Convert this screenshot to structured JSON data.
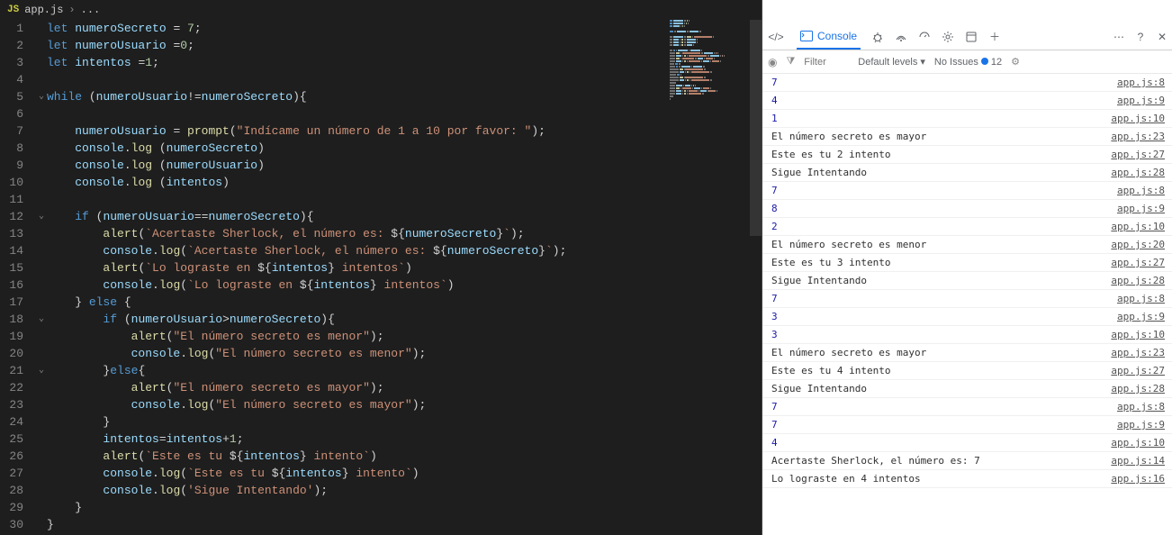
{
  "editor": {
    "file_icon": "JS",
    "file_name": "app.js",
    "breadcrumb_rest": "...",
    "line_numbers": [
      "1",
      "2",
      "3",
      "4",
      "5",
      "6",
      "7",
      "8",
      "9",
      "10",
      "11",
      "12",
      "13",
      "14",
      "15",
      "16",
      "17",
      "18",
      "19",
      "20",
      "21",
      "22",
      "23",
      "24",
      "25",
      "26",
      "27",
      "28",
      "29",
      "30"
    ],
    "fold_markers": {
      "5": "v",
      "12": "v",
      "18": "v",
      "21": "v"
    },
    "code_lines": [
      [
        [
          "kw",
          "let "
        ],
        [
          "var",
          "numeroSecreto"
        ],
        [
          "pun",
          " = "
        ],
        [
          "num",
          "7"
        ],
        [
          "pun",
          ";"
        ]
      ],
      [
        [
          "kw",
          "let "
        ],
        [
          "var",
          "numeroUsuario"
        ],
        [
          "pun",
          " ="
        ],
        [
          "num",
          "0"
        ],
        [
          "pun",
          ";"
        ]
      ],
      [
        [
          "kw",
          "let "
        ],
        [
          "var",
          "intentos"
        ],
        [
          "pun",
          " ="
        ],
        [
          "num",
          "1"
        ],
        [
          "pun",
          ";"
        ]
      ],
      [],
      [
        [
          "kw",
          "while"
        ],
        [
          "pun",
          " ("
        ],
        [
          "var",
          "numeroUsuario"
        ],
        [
          "pun",
          "!="
        ],
        [
          "var",
          "numeroSecreto"
        ],
        [
          "pun",
          "){"
        ]
      ],
      [],
      [
        [
          "pun",
          "    "
        ],
        [
          "var",
          "numeroUsuario"
        ],
        [
          "pun",
          " = "
        ],
        [
          "fn",
          "prompt"
        ],
        [
          "pun",
          "("
        ],
        [
          "str",
          "\"Indícame un número de 1 a 10 por favor: \""
        ],
        [
          "pun",
          ");"
        ]
      ],
      [
        [
          "pun",
          "    "
        ],
        [
          "var",
          "console"
        ],
        [
          "pun",
          "."
        ],
        [
          "fn",
          "log"
        ],
        [
          "pun",
          " ("
        ],
        [
          "var",
          "numeroSecreto"
        ],
        [
          "pun",
          ")"
        ]
      ],
      [
        [
          "pun",
          "    "
        ],
        [
          "var",
          "console"
        ],
        [
          "pun",
          "."
        ],
        [
          "fn",
          "log"
        ],
        [
          "pun",
          " ("
        ],
        [
          "var",
          "numeroUsuario"
        ],
        [
          "pun",
          ")"
        ]
      ],
      [
        [
          "pun",
          "    "
        ],
        [
          "var",
          "console"
        ],
        [
          "pun",
          "."
        ],
        [
          "fn",
          "log"
        ],
        [
          "pun",
          " ("
        ],
        [
          "var",
          "intentos"
        ],
        [
          "pun",
          ")"
        ]
      ],
      [],
      [
        [
          "pun",
          "    "
        ],
        [
          "kw",
          "if"
        ],
        [
          "pun",
          " ("
        ],
        [
          "var",
          "numeroUsuario"
        ],
        [
          "pun",
          "=="
        ],
        [
          "var",
          "numeroSecreto"
        ],
        [
          "pun",
          "){"
        ]
      ],
      [
        [
          "pun",
          "        "
        ],
        [
          "fn",
          "alert"
        ],
        [
          "pun",
          "("
        ],
        [
          "tpl",
          "`Acertaste Sherlock, el número es: "
        ],
        [
          "pun",
          "${"
        ],
        [
          "var",
          "numeroSecreto"
        ],
        [
          "pun",
          "}"
        ],
        [
          "tpl",
          "`"
        ],
        [
          "pun",
          ");"
        ]
      ],
      [
        [
          "pun",
          "        "
        ],
        [
          "var",
          "console"
        ],
        [
          "pun",
          "."
        ],
        [
          "fn",
          "log"
        ],
        [
          "pun",
          "("
        ],
        [
          "tpl",
          "`Acertaste Sherlock, el número es: "
        ],
        [
          "pun",
          "${"
        ],
        [
          "var",
          "numeroSecreto"
        ],
        [
          "pun",
          "}"
        ],
        [
          "tpl",
          "`"
        ],
        [
          "pun",
          ");"
        ]
      ],
      [
        [
          "pun",
          "        "
        ],
        [
          "fn",
          "alert"
        ],
        [
          "pun",
          "("
        ],
        [
          "tpl",
          "`Lo lograste en "
        ],
        [
          "pun",
          "${"
        ],
        [
          "var",
          "intentos"
        ],
        [
          "pun",
          "}"
        ],
        [
          "tpl",
          " intentos`"
        ],
        [
          "pun",
          ")"
        ]
      ],
      [
        [
          "pun",
          "        "
        ],
        [
          "var",
          "console"
        ],
        [
          "pun",
          "."
        ],
        [
          "fn",
          "log"
        ],
        [
          "pun",
          "("
        ],
        [
          "tpl",
          "`Lo lograste en "
        ],
        [
          "pun",
          "${"
        ],
        [
          "var",
          "intentos"
        ],
        [
          "pun",
          "}"
        ],
        [
          "tpl",
          " intentos`"
        ],
        [
          "pun",
          ")"
        ]
      ],
      [
        [
          "pun",
          "    } "
        ],
        [
          "kw",
          "else"
        ],
        [
          "pun",
          " {"
        ]
      ],
      [
        [
          "pun",
          "        "
        ],
        [
          "kw",
          "if"
        ],
        [
          "pun",
          " ("
        ],
        [
          "var",
          "numeroUsuario"
        ],
        [
          "pun",
          ">"
        ],
        [
          "var",
          "numeroSecreto"
        ],
        [
          "pun",
          "){"
        ]
      ],
      [
        [
          "pun",
          "            "
        ],
        [
          "fn",
          "alert"
        ],
        [
          "pun",
          "("
        ],
        [
          "str",
          "\"El número secreto es menor\""
        ],
        [
          "pun",
          ");"
        ]
      ],
      [
        [
          "pun",
          "            "
        ],
        [
          "var",
          "console"
        ],
        [
          "pun",
          "."
        ],
        [
          "fn",
          "log"
        ],
        [
          "pun",
          "("
        ],
        [
          "str",
          "\"El número secreto es menor\""
        ],
        [
          "pun",
          ");"
        ]
      ],
      [
        [
          "pun",
          "        }"
        ],
        [
          "kw",
          "else"
        ],
        [
          "pun",
          "{"
        ]
      ],
      [
        [
          "pun",
          "            "
        ],
        [
          "fn",
          "alert"
        ],
        [
          "pun",
          "("
        ],
        [
          "str",
          "\"El número secreto es mayor\""
        ],
        [
          "pun",
          ");"
        ]
      ],
      [
        [
          "pun",
          "            "
        ],
        [
          "var",
          "console"
        ],
        [
          "pun",
          "."
        ],
        [
          "fn",
          "log"
        ],
        [
          "pun",
          "("
        ],
        [
          "str",
          "\"El número secreto es mayor\""
        ],
        [
          "pun",
          ");"
        ]
      ],
      [
        [
          "pun",
          "        }"
        ]
      ],
      [
        [
          "pun",
          "        "
        ],
        [
          "var",
          "intentos"
        ],
        [
          "pun",
          "="
        ],
        [
          "var",
          "intentos"
        ],
        [
          "pun",
          "+"
        ],
        [
          "num",
          "1"
        ],
        [
          "pun",
          ";"
        ]
      ],
      [
        [
          "pun",
          "        "
        ],
        [
          "fn",
          "alert"
        ],
        [
          "pun",
          "("
        ],
        [
          "tpl",
          "`Este es tu "
        ],
        [
          "pun",
          "${"
        ],
        [
          "var",
          "intentos"
        ],
        [
          "pun",
          "}"
        ],
        [
          "tpl",
          " intento`"
        ],
        [
          "pun",
          ")"
        ]
      ],
      [
        [
          "pun",
          "        "
        ],
        [
          "var",
          "console"
        ],
        [
          "pun",
          "."
        ],
        [
          "fn",
          "log"
        ],
        [
          "pun",
          "("
        ],
        [
          "tpl",
          "`Este es tu "
        ],
        [
          "pun",
          "${"
        ],
        [
          "var",
          "intentos"
        ],
        [
          "pun",
          "}"
        ],
        [
          "tpl",
          " intento`"
        ],
        [
          "pun",
          ")"
        ]
      ],
      [
        [
          "pun",
          "        "
        ],
        [
          "var",
          "console"
        ],
        [
          "pun",
          "."
        ],
        [
          "fn",
          "log"
        ],
        [
          "pun",
          "("
        ],
        [
          "str",
          "'Sigue Intentando'"
        ],
        [
          "pun",
          ");"
        ]
      ],
      [
        [
          "pun",
          "    }"
        ]
      ],
      [
        [
          "pun",
          "}"
        ]
      ]
    ]
  },
  "devtools": {
    "tabs": {
      "elements_icon": "</>",
      "console": "Console"
    },
    "filter_placeholder": "Filter",
    "levels": "Default levels",
    "no_issues": "No Issues",
    "issue_count": "12",
    "console_rows": [
      {
        "msg": "7",
        "num": true,
        "link": "app.js:8"
      },
      {
        "msg": "4",
        "num": true,
        "link": "app.js:9"
      },
      {
        "msg": "1",
        "num": true,
        "link": "app.js:10"
      },
      {
        "msg": "El número secreto es mayor",
        "link": "app.js:23"
      },
      {
        "msg": "Este es tu 2 intento",
        "link": "app.js:27"
      },
      {
        "msg": "Sigue Intentando",
        "link": "app.js:28"
      },
      {
        "msg": "7",
        "num": true,
        "link": "app.js:8"
      },
      {
        "msg": "8",
        "num": true,
        "link": "app.js:9"
      },
      {
        "msg": "2",
        "num": true,
        "link": "app.js:10"
      },
      {
        "msg": "El número secreto es menor",
        "link": "app.js:20"
      },
      {
        "msg": "Este es tu 3 intento",
        "link": "app.js:27"
      },
      {
        "msg": "Sigue Intentando",
        "link": "app.js:28"
      },
      {
        "msg": "7",
        "num": true,
        "link": "app.js:8"
      },
      {
        "msg": "3",
        "num": true,
        "link": "app.js:9"
      },
      {
        "msg": "3",
        "num": true,
        "link": "app.js:10"
      },
      {
        "msg": "El número secreto es mayor",
        "link": "app.js:23"
      },
      {
        "msg": "Este es tu 4 intento",
        "link": "app.js:27"
      },
      {
        "msg": "Sigue Intentando",
        "link": "app.js:28"
      },
      {
        "msg": "7",
        "num": true,
        "link": "app.js:8"
      },
      {
        "msg": "7",
        "num": true,
        "link": "app.js:9"
      },
      {
        "msg": "4",
        "num": true,
        "link": "app.js:10"
      },
      {
        "msg": "Acertaste Sherlock, el número es: 7",
        "link": "app.js:14"
      },
      {
        "msg": "Lo lograste en 4 intentos",
        "link": "app.js:16"
      }
    ]
  }
}
